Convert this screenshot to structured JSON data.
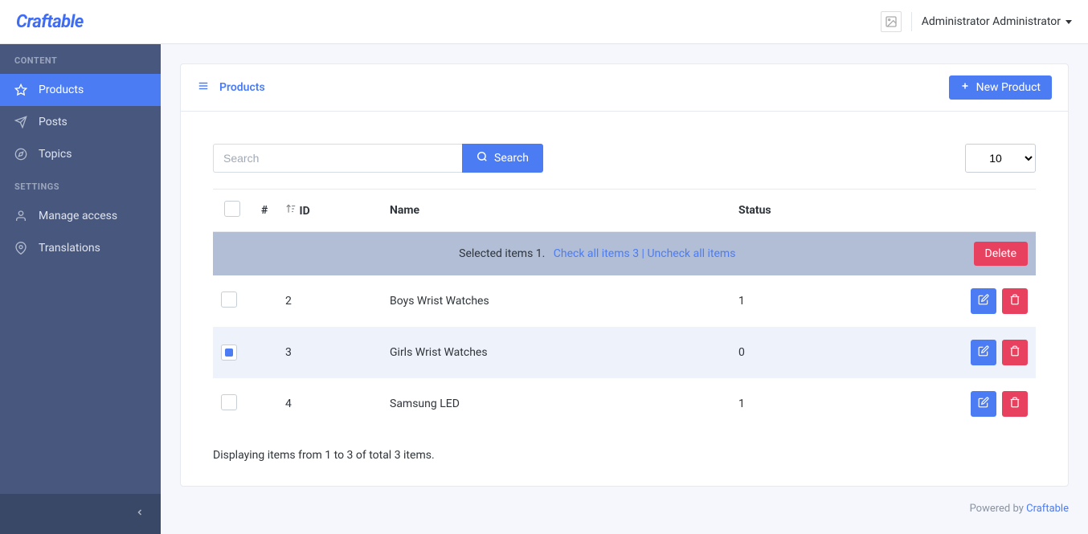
{
  "header": {
    "brand": "Craftable",
    "user_label": "Administrator Administrator"
  },
  "sidebar": {
    "section_content": "CONTENT",
    "section_settings": "SETTINGS",
    "items": {
      "products": "Products",
      "posts": "Posts",
      "topics": "Topics",
      "manage_access": "Manage access",
      "translations": "Translations"
    }
  },
  "card": {
    "title": "Products",
    "new_button": "New Product"
  },
  "toolbar": {
    "search_placeholder": "Search",
    "search_button": "Search",
    "page_size": "10"
  },
  "table": {
    "headers": {
      "hash": "#",
      "id": "ID",
      "name": "Name",
      "status": "Status"
    },
    "selected_bar": {
      "text": "Selected items 1.",
      "check_all": "Check all items 3",
      "separator": " | ",
      "uncheck_all": "Uncheck all items",
      "delete": "Delete"
    },
    "rows": [
      {
        "id": "2",
        "name": "Boys Wrist Watches",
        "status": "1",
        "checked": false
      },
      {
        "id": "3",
        "name": "Girls Wrist Watches",
        "status": "0",
        "checked": true
      },
      {
        "id": "4",
        "name": "Samsung LED",
        "status": "1",
        "checked": false
      }
    ],
    "pagination_info": "Displaying items from 1 to 3 of total 3 items."
  },
  "footer": {
    "powered": "Powered by ",
    "link": "Craftable"
  }
}
